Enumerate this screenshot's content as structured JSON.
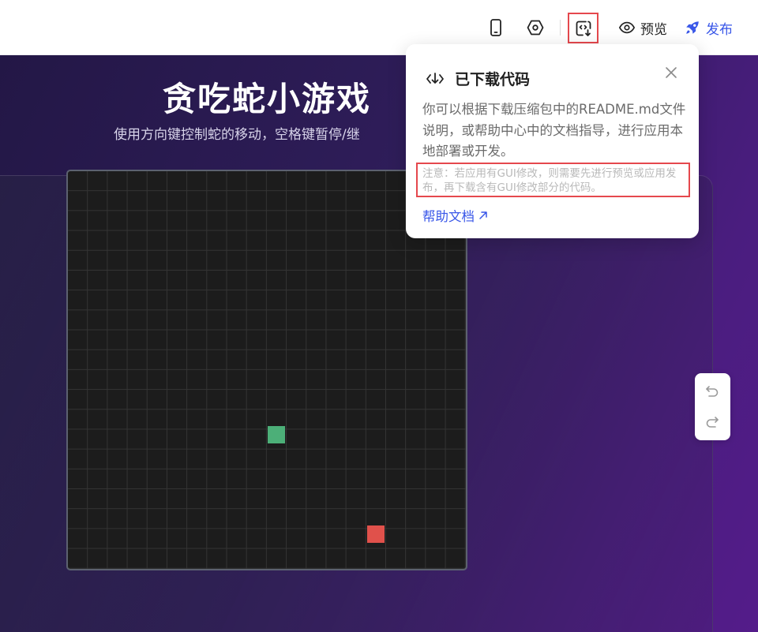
{
  "toolbar": {
    "preview_label": "预览",
    "publish_label": "发布",
    "icons": [
      "mobile-icon",
      "settings-hex-icon",
      "code-download-icon",
      "eye-icon",
      "rocket-icon"
    ],
    "accent_color": "#3856e8",
    "highlight_color": "#e5484d"
  },
  "game": {
    "title": "贪吃蛇小游戏",
    "subtitle": "使用方向键控制蛇的移动，空格键暂停/继",
    "snake_color": "#4caf78",
    "food_color": "#e0514b"
  },
  "popover": {
    "title": "已下载代码",
    "body": "你可以根据下载压缩包中的README.md文件说明，或帮助中心中的文档指导，进行应用本地部署或开发。",
    "note": "注意：若应用有GUI修改，则需要先进行预览或应用发布，再下载含有GUI修改部分的代码。",
    "link_label": "帮助文档"
  }
}
